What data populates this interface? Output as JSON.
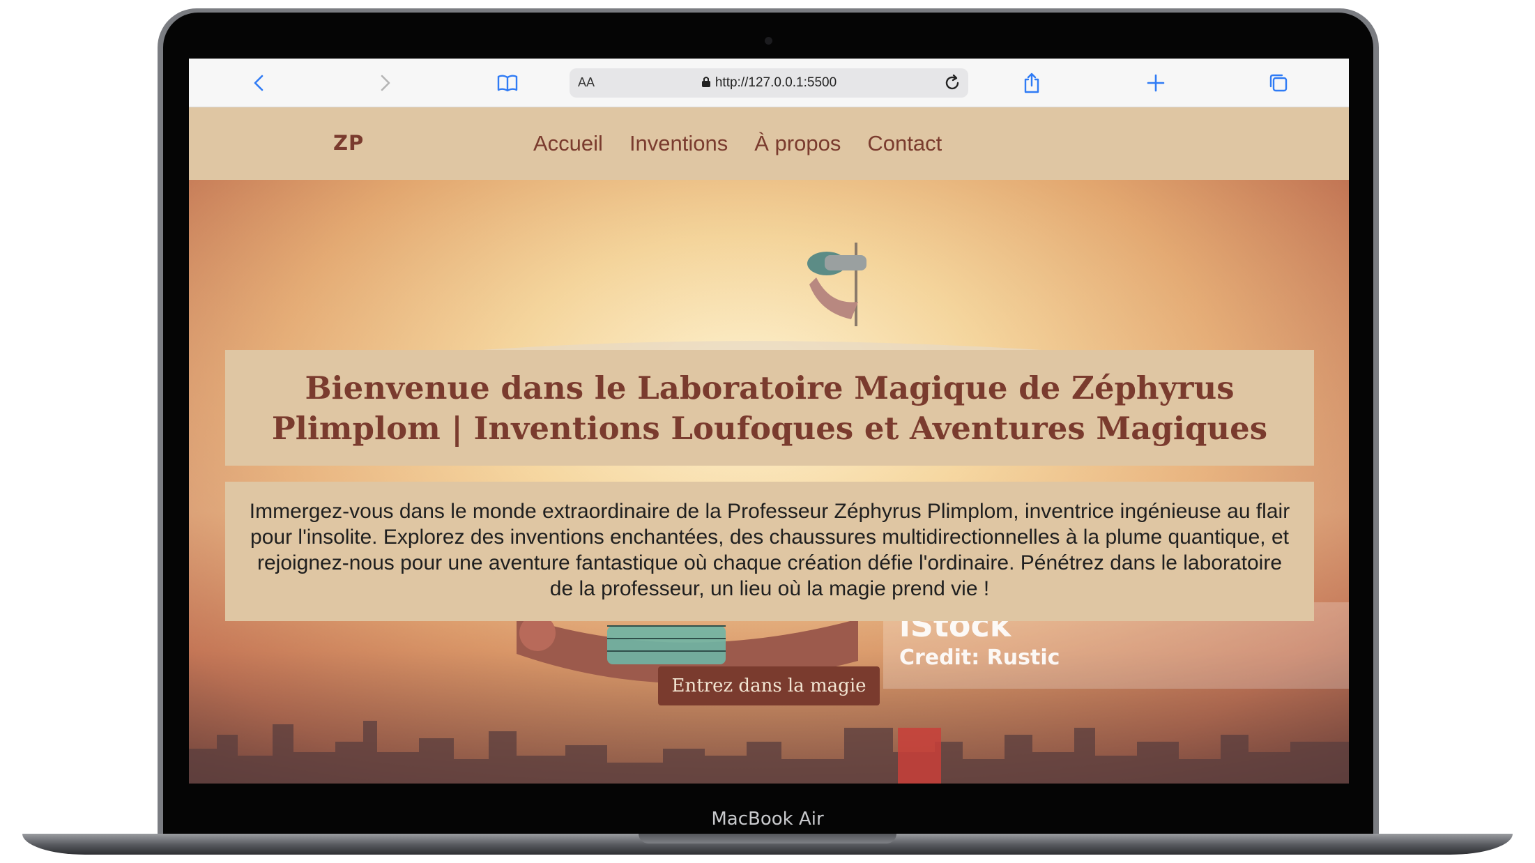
{
  "device": {
    "label": "MacBook Air"
  },
  "browser": {
    "reader_label": "AA",
    "url": "http://127.0.0.1:5500",
    "icons": [
      "back-icon",
      "forward-icon",
      "bookmarks-icon",
      "lock-icon",
      "reload-icon",
      "share-icon",
      "new-tab-icon",
      "tabs-icon"
    ]
  },
  "site": {
    "logo": "ZP",
    "nav": [
      "Accueil",
      "Inventions",
      "À propos",
      "Contact"
    ],
    "hero": {
      "title": "Bienvenue dans le Laboratoire Magique de Zéphyrus Plimplom | Inventions Loufoques et Aventures Magiques",
      "description": "Immergez-vous dans le monde extraordinaire de la Professeur Zéphyrus Plimplom, inventrice ingénieuse au flair pour l'insolite. Explorez des inventions enchantées, des chaussures multidirectionnelles à la plume quantique, et rejoignez-nous pour une aventure fantastique où chaque création défie l'ordinaire. Pénétrez dans le laboratoire de la professeur, un lieu où la magie prend vie !",
      "cta": "Entrez dans la magie",
      "watermark": {
        "logo": "iStock",
        "credit": "Credit: Rustic"
      }
    }
  },
  "colors": {
    "nav_bg": "#dfc6a3",
    "brand_text": "#7a3b2e",
    "cta_bg": "#7a3b2e",
    "browser_icon": "#2f7bf5"
  }
}
